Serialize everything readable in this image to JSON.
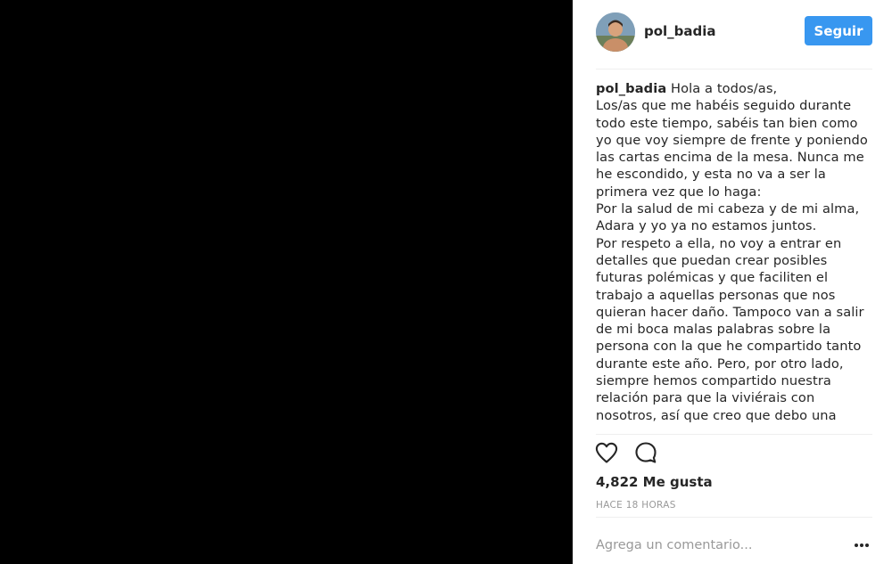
{
  "post": {
    "username": "pol_badia",
    "follow_label": "Seguir",
    "caption_user": "pol_badia",
    "caption_lines": [
      "Hola a todos/as,",
      "Los/as que me habéis seguido durante",
      "todo este tiempo, sabéis tan bien como",
      "yo que voy siempre de frente y poniendo",
      "las cartas encima de la mesa. Nunca me",
      "he escondido, y esta no va a ser la",
      "primera vez que lo haga:",
      "Por la salud de mi cabeza y de mi alma,",
      "Adara y yo ya no estamos juntos.",
      "Por respeto a ella, no voy a entrar en",
      "detalles que puedan crear posibles",
      "futuras polémicas y que faciliten el",
      "trabajo a aquellas personas que nos",
      "quieran hacer daño. Tampoco van a salir",
      "de mi boca malas palabras sobre la",
      "persona con la que he compartido tanto",
      "durante este año. Pero, por otro lado,",
      "siempre hemos compartido nuestra",
      "relación para que la viviérais con",
      "nosotros, así que creo que debo una"
    ],
    "likes": "4,822 Me gusta",
    "time": "HACE 18 HORAS",
    "comment_placeholder": "Agrega un comentario..."
  },
  "colors": {
    "follow_button": "#3897f0",
    "media_background": "#000000"
  },
  "icons": {
    "like": "heart-icon",
    "comment": "comment-bubble-icon",
    "more": "more-options-icon"
  }
}
